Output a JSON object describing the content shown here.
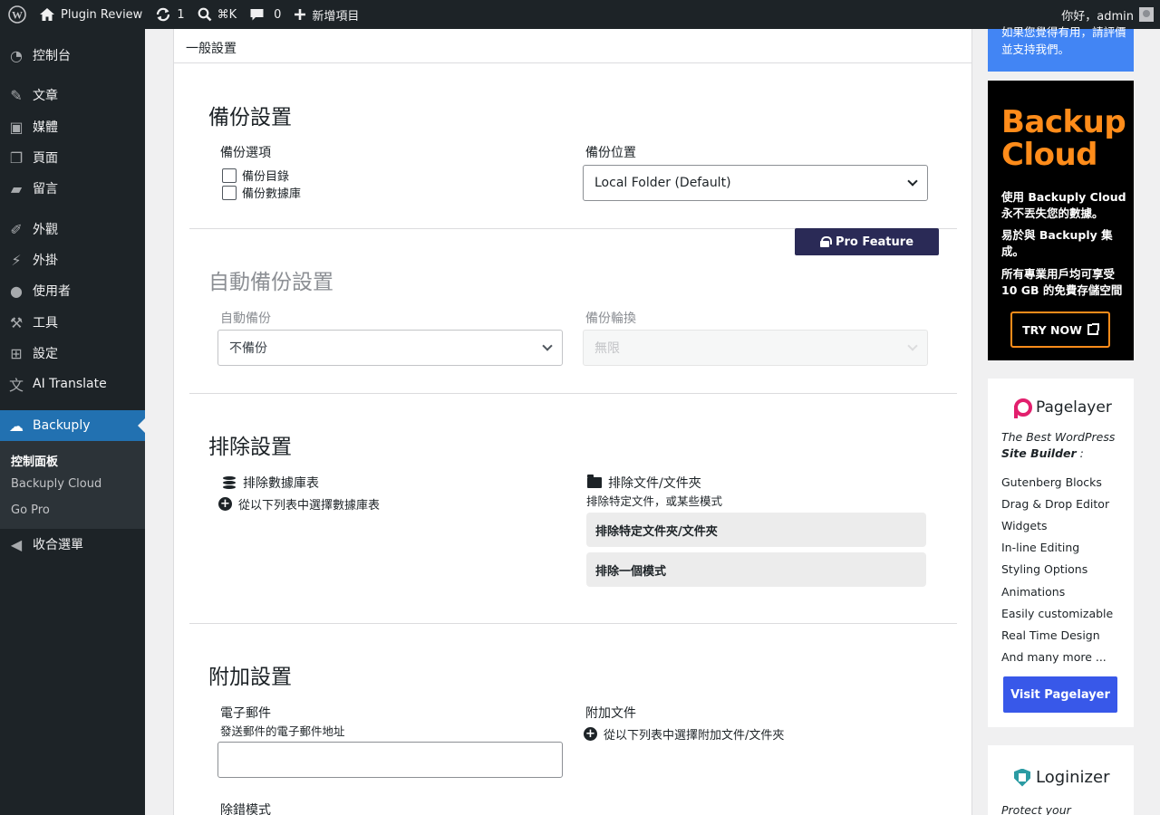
{
  "adminbar": {
    "site_name": "Plugin Review",
    "updates_count": "1",
    "command_shortcut": "⌘K",
    "comments_count": "0",
    "new_label": "新增項目",
    "greeting": "你好，admin"
  },
  "sidebar": {
    "items": [
      {
        "label": "控制台",
        "icon": "dashboard-icon"
      },
      {
        "label": "文章",
        "icon": "pin-icon"
      },
      {
        "label": "媒體",
        "icon": "media-icon"
      },
      {
        "label": "頁面",
        "icon": "page-icon"
      },
      {
        "label": "留言",
        "icon": "comment-icon"
      },
      {
        "label": "外觀",
        "icon": "brush-icon"
      },
      {
        "label": "外掛",
        "icon": "plugin-icon"
      },
      {
        "label": "使用者",
        "icon": "user-icon"
      },
      {
        "label": "工具",
        "icon": "wrench-icon"
      },
      {
        "label": "設定",
        "icon": "settings-icon"
      },
      {
        "label": "AI Translate",
        "icon": "translate-icon"
      },
      {
        "label": "Backuply",
        "icon": "cloud-upload-icon"
      }
    ],
    "submenu": [
      "控制面板",
      "Backuply Cloud",
      "Go Pro"
    ],
    "collapse_label": "收合選單"
  },
  "main": {
    "header": "一般設置",
    "backup": {
      "title": "備份設置",
      "options_label": "備份選項",
      "option_dirs": "備份目錄",
      "option_db": "備份數據庫",
      "location_label": "備份位置",
      "location_value": "Local Folder (Default)"
    },
    "pro_badge": "Pro Feature",
    "auto": {
      "title": "自動備份設置",
      "auto_label": "自動備份",
      "auto_value": "不備份",
      "rotation_label": "備份輪換",
      "rotation_value": "無限"
    },
    "exclude": {
      "title": "排除設置",
      "db_label": "排除數據庫表",
      "db_action": "從以下列表中選擇數據庫表",
      "files_label": "排除文件/文件夾",
      "files_desc": "排除特定文件，或某些模式",
      "btn_specific": "排除特定文件夾/文件夾",
      "btn_pattern": "排除一個模式"
    },
    "additional": {
      "title": "附加設置",
      "email_label": "電子郵件",
      "email_desc": "發送郵件的電子郵件地址",
      "email_value": "",
      "attach_label": "附加文件",
      "attach_action": "從以下列表中選擇附加文件/文件夾",
      "debug_label": "除錯模式"
    }
  },
  "right": {
    "blue_text": "如果您覺得有用，請評價並支持我們。",
    "cloud_logo_1": "Backup",
    "cloud_logo_2": "Cloud",
    "cloud_lines": [
      "使用 Backuply Cloud 永不丟失您的數據。",
      "易於與 Backuply 集成。",
      "所有專業用戶均可享受 10 GB 的免費存儲空間"
    ],
    "try_now": "TRY NOW",
    "pagelayer_name": "Pagelayer",
    "pagelayer_tag_1": "The Best WordPress",
    "pagelayer_tag_2": "Site Builder",
    "pagelayer_tag_colon": " :",
    "pagelayer_features": [
      "Gutenberg Blocks",
      "Drag & Drop Editor",
      "Widgets",
      "In-line Editing",
      "Styling Options",
      "Animations",
      "Easily customizable",
      "Real Time Design",
      "And many more ..."
    ],
    "visit_label": "Visit Pagelayer",
    "loginizer_name": "Loginizer",
    "loginizer_tag": "Protect your"
  },
  "colors": {
    "admin_dark": "#1d2327",
    "active_blue": "#2271b1",
    "pro_badge": "#2a2a56",
    "cloud_orange": "#ff8c1a",
    "pagelayer_pink": "#e21f6d",
    "visit_blue": "#3858e9"
  }
}
